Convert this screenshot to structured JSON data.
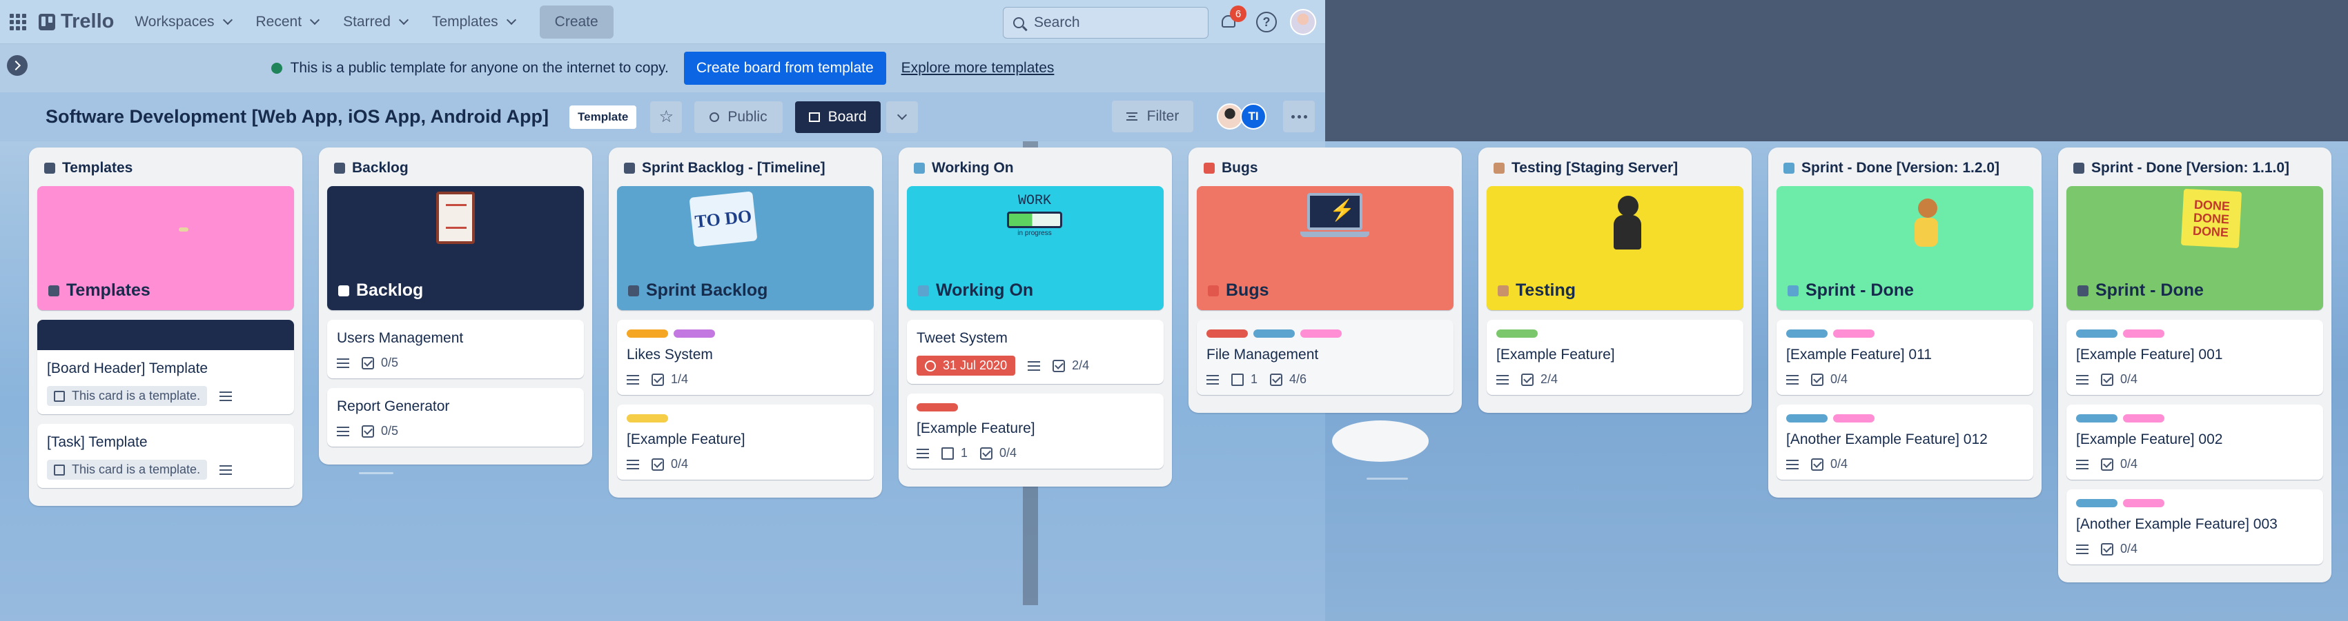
{
  "topnav": {
    "logo": "Trello",
    "workspaces": "Workspaces",
    "recent": "Recent",
    "starred": "Starred",
    "templates": "Templates",
    "create": "Create",
    "search_placeholder": "Search",
    "notification_count": "6",
    "help": "?"
  },
  "banner": {
    "text": "This is a public template for anyone on the internet to copy.",
    "create_button": "Create board from template",
    "explore_link": "Explore more templates"
  },
  "board": {
    "title": "Software Development [Web App, iOS App, Android App]",
    "template_badge": "Template",
    "visibility": "Public",
    "view": "Board",
    "filter": "Filter",
    "member_initials": "TI"
  },
  "lists": [
    {
      "title": "Templates",
      "emoji_color": "#44546f",
      "cover": {
        "title": "Templates",
        "color": "#ff8ed4",
        "light": false
      },
      "cards": [
        {
          "title": "[Board Header] Template",
          "strip": true,
          "template": "This card is a template.",
          "desc": true
        },
        {
          "title": "[Task] Template",
          "template": "This card is a template.",
          "desc": true
        }
      ]
    },
    {
      "title": "Backlog",
      "emoji_color": "#44546f",
      "cover": {
        "title": "Backlog",
        "color": "#1d2b4c",
        "light": true
      },
      "cards": [
        {
          "title": "Users Management",
          "desc": true,
          "checklist": "0/5"
        },
        {
          "title": "Report Generator",
          "desc": true,
          "checklist": "0/5"
        }
      ]
    },
    {
      "title": "Sprint Backlog - [Timeline]",
      "emoji_color": "#44546f",
      "cover": {
        "title": "Sprint Backlog",
        "color": "#5ba4cf",
        "light": false
      },
      "cards": [
        {
          "title": "Likes System",
          "labels": [
            "#f5a623",
            "#c377e0"
          ],
          "desc": true,
          "checklist": "1/4"
        },
        {
          "title": "[Example Feature]",
          "labels": [
            "#f5cd47"
          ],
          "desc": true,
          "checklist": "0/4"
        }
      ]
    },
    {
      "title": "Working On",
      "emoji_color": "#5ba4cf",
      "cover": {
        "title": "Working On",
        "color": "#29cce5",
        "light": false
      },
      "cards": [
        {
          "title": "Tweet System",
          "date": "31 Jul 2020",
          "desc": true,
          "checklist": "2/4"
        },
        {
          "title": "[Example Feature]",
          "labels": [
            "#e2574c"
          ],
          "desc": true,
          "attachments": "1",
          "checklist": "0/4"
        }
      ]
    },
    {
      "title": "Bugs",
      "emoji_color": "#e2574c",
      "cover": {
        "title": "Bugs",
        "color": "#ef7564",
        "light": false
      },
      "cards": [
        {
          "title": "File Management",
          "greyed": true,
          "labels": [
            "#e2574c",
            "#5ba4cf",
            "#ff8ed4"
          ],
          "desc": true,
          "attachments": "1",
          "checklist": "4/6"
        }
      ]
    },
    {
      "title": "Testing [Staging Server]",
      "emoji_color": "#c9926a",
      "cover": {
        "title": "Testing",
        "color": "#f5dd29",
        "light": false
      },
      "cards": [
        {
          "title": "[Example Feature]",
          "labels": [
            "#7bc86c"
          ],
          "desc": true,
          "checklist": "2/4"
        }
      ]
    },
    {
      "title": "Sprint - Done [Version: 1.2.0]",
      "emoji_color": "#5ba4cf",
      "cover": {
        "title": "Sprint - Done",
        "color": "#6deca9",
        "light": false
      },
      "cards": [
        {
          "title": "[Example Feature] 011",
          "labels": [
            "#5ba4cf",
            "#ff8ed4"
          ],
          "desc": true,
          "checklist": "0/4"
        },
        {
          "title": "[Another Example Feature] 012",
          "labels": [
            "#5ba4cf",
            "#ff8ed4"
          ],
          "desc": true,
          "checklist": "0/4"
        }
      ]
    },
    {
      "title": "Sprint - Done [Version: 1.1.0]",
      "emoji_color": "#44546f",
      "cover": {
        "title": "Sprint - Done",
        "color": "#7bc86c",
        "light": false
      },
      "cards": [
        {
          "title": "[Example Feature] 001",
          "labels": [
            "#5ba4cf",
            "#ff8ed4"
          ],
          "desc": true,
          "checklist": "0/4"
        },
        {
          "title": "[Example Feature] 002",
          "labels": [
            "#5ba4cf",
            "#ff8ed4"
          ],
          "desc": true,
          "checklist": "0/4"
        },
        {
          "title": "[Another Example Feature] 003",
          "labels": [
            "#5ba4cf",
            "#ff8ed4"
          ],
          "desc": true,
          "checklist": "0/4"
        }
      ]
    }
  ],
  "cover_art": {
    "backlog_art": "clipboard",
    "sprint_art_text": "TO DO",
    "working_art_text": "WORK",
    "working_art_sub": "in progress",
    "done_art_text": "DONE DONE DONE"
  }
}
